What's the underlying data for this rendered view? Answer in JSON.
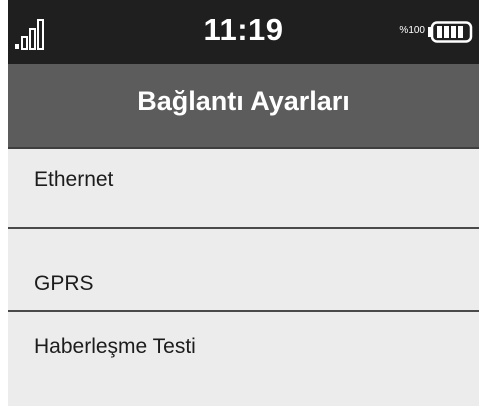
{
  "status_bar": {
    "time": "11:19",
    "battery_text": "%100",
    "signal_icon": "signal-bars-icon",
    "battery_icon": "battery-full-icon"
  },
  "header": {
    "title": "Bağlantı Ayarları"
  },
  "menu": {
    "items": [
      {
        "label": "Ethernet"
      },
      {
        "label": "GPRS"
      },
      {
        "label": "Haberleşme Testi"
      }
    ]
  },
  "colors": {
    "status_bar_bg": "#1f1f1f",
    "title_bar_bg": "#5c5c5c",
    "list_bg": "#ececec",
    "divider": "#4a4a4a"
  }
}
